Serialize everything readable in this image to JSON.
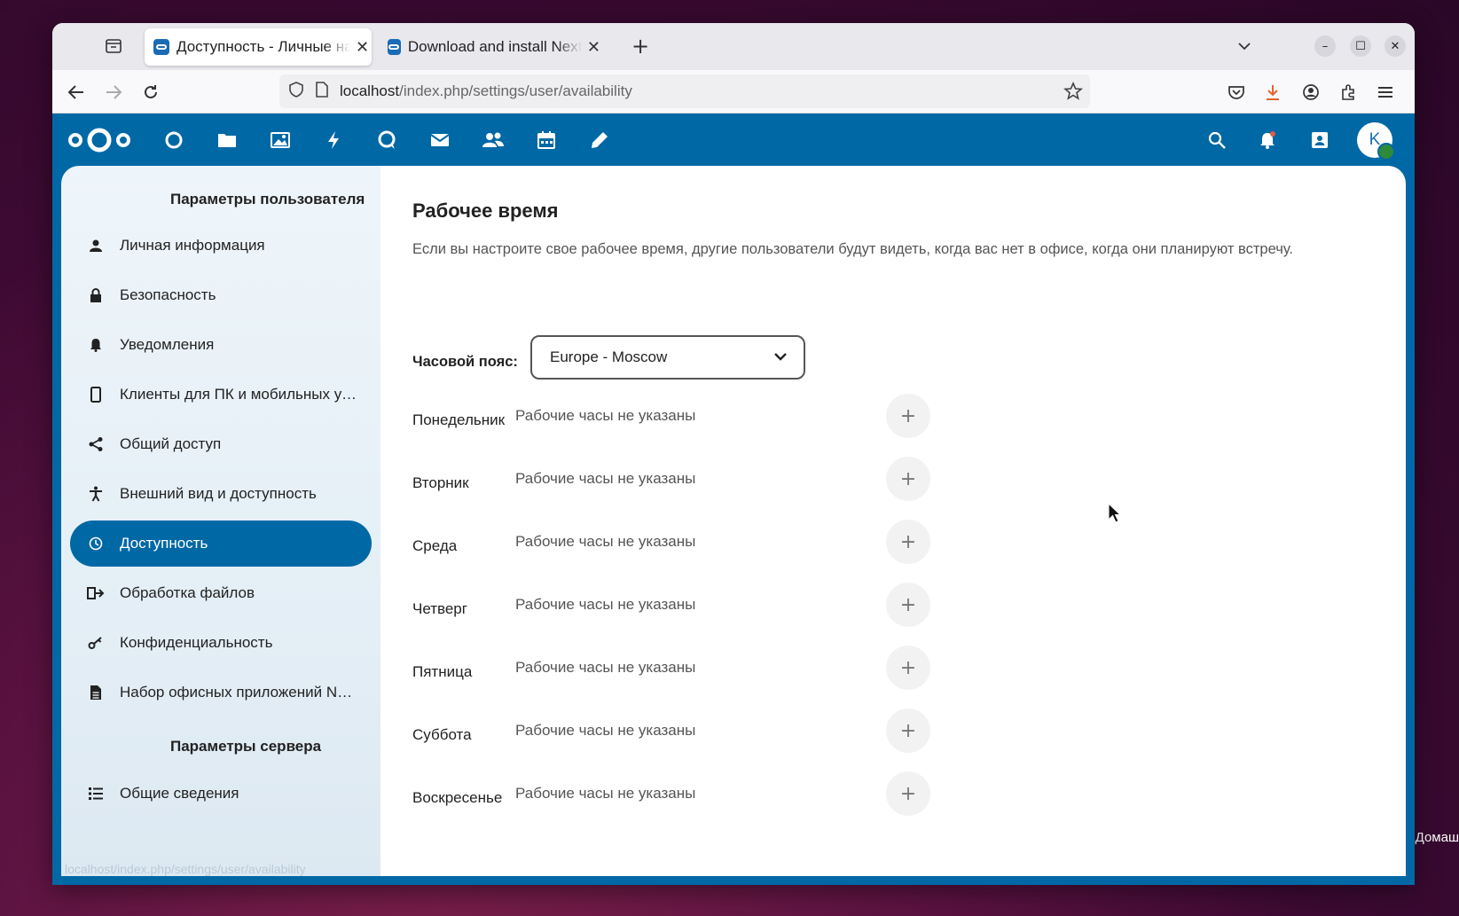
{
  "browser": {
    "tabs": [
      {
        "title": "Доступность - Личные настройки",
        "active": true
      },
      {
        "title": "Download and install Nextcloud",
        "active": false
      }
    ],
    "url_host": "localhost",
    "url_path": "/index.php/settings/user/availability",
    "status_url": "localhost/index.php/settings/user/availability"
  },
  "header": {
    "apps": [
      "dashboard-icon",
      "files-icon",
      "photos-icon",
      "activity-icon",
      "talk-icon",
      "mail-icon",
      "contacts-icon",
      "calendar-icon",
      "notes-icon"
    ],
    "avatar_letter": "K",
    "brand_color": "#0068a5"
  },
  "sidebar": {
    "personal_header": "Параметры пользователя",
    "items": [
      {
        "label": "Личная информация",
        "icon": "user-icon"
      },
      {
        "label": "Безопасность",
        "icon": "lock-icon"
      },
      {
        "label": "Уведомления",
        "icon": "bell-icon"
      },
      {
        "label": "Клиенты для ПК и мобильных устройств",
        "icon": "phone-icon"
      },
      {
        "label": "Общий доступ",
        "icon": "share-icon"
      },
      {
        "label": "Внешний вид и доступность",
        "icon": "accessibility-icon"
      },
      {
        "label": "Доступность",
        "icon": "clock-icon",
        "active": true
      },
      {
        "label": "Обработка файлов",
        "icon": "file-process-icon"
      },
      {
        "label": "Конфиденциальность",
        "icon": "key-icon"
      },
      {
        "label": "Набор офисных приложений Nextcloud",
        "icon": "document-icon"
      }
    ],
    "server_header": "Параметры сервера",
    "server_items": [
      {
        "label": "Общие сведения",
        "icon": "list-icon"
      }
    ]
  },
  "main": {
    "title": "Рабочее время",
    "description": "Если вы настроите свое рабочее время, другие пользователи будут видеть, когда вас нет в офисе, когда они планируют встречу.",
    "timezone_label": "Часовой пояс:",
    "timezone_value": "Europe - Moscow",
    "no_hours_text": "Рабочие часы не указаны",
    "days": [
      "Понедельник",
      "Вторник",
      "Среда",
      "Четверг",
      "Пятница",
      "Суббота",
      "Воскресенье"
    ],
    "add_symbol": "+"
  },
  "desktop_label": "Домаш"
}
